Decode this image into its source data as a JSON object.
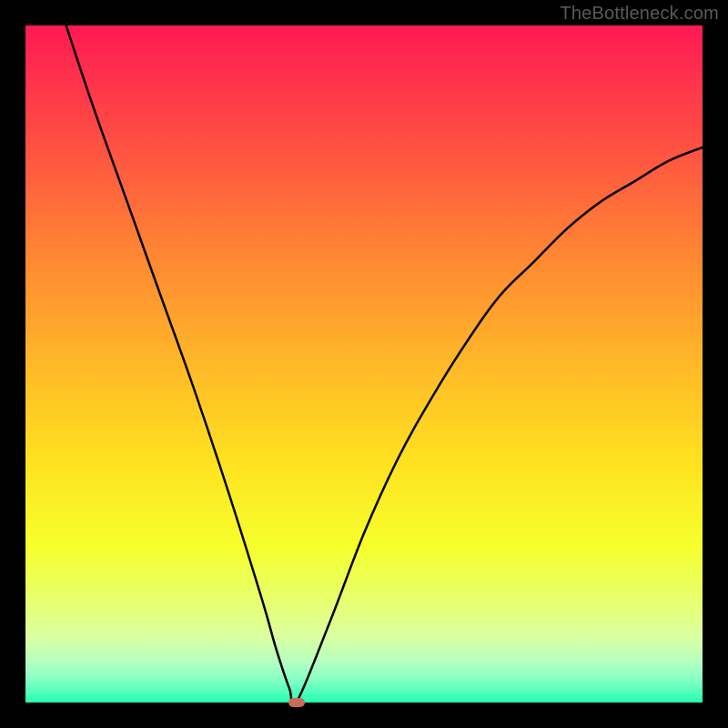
{
  "watermark": "TheBottleneck.com",
  "chart_data": {
    "type": "line",
    "title": "",
    "xlabel": "",
    "ylabel": "",
    "xlim": [
      0,
      100
    ],
    "ylim": [
      0,
      100
    ],
    "series": [
      {
        "name": "curve",
        "x": [
          6,
          10,
          15,
          20,
          25,
          30,
          35,
          37,
          39,
          40,
          45,
          50,
          55,
          60,
          65,
          70,
          75,
          80,
          85,
          90,
          95,
          100
        ],
        "values": [
          100,
          88,
          74,
          60,
          46,
          31,
          15,
          8,
          2,
          0,
          12,
          25,
          36,
          45,
          53,
          60,
          65,
          70,
          74,
          77,
          80,
          82
        ]
      }
    ],
    "marker": {
      "x": 40,
      "y": 0
    },
    "gradient_stops": [
      {
        "pos": 0,
        "color": "#ff1954"
      },
      {
        "pos": 20,
        "color": "#ff5840"
      },
      {
        "pos": 35,
        "color": "#ff8a32"
      },
      {
        "pos": 50,
        "color": "#ffb828"
      },
      {
        "pos": 65,
        "color": "#ffe31f"
      },
      {
        "pos": 77,
        "color": "#f6ff2c"
      },
      {
        "pos": 84,
        "color": "#e9ff66"
      },
      {
        "pos": 90,
        "color": "#dcff9e"
      },
      {
        "pos": 94,
        "color": "#b6ffc1"
      },
      {
        "pos": 97,
        "color": "#7dffc4"
      },
      {
        "pos": 100,
        "color": "#22ffb0"
      }
    ]
  }
}
